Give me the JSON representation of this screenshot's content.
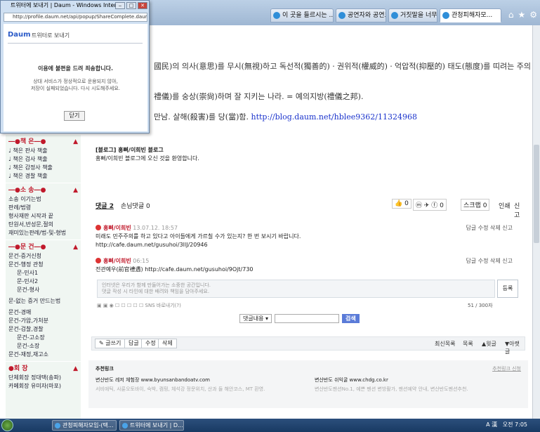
{
  "browser": {
    "tabs": [
      {
        "label": "이 곳을 들르시는 ..."
      },
      {
        "label": "공연자와 공연도..."
      },
      {
        "label": "거짓말을 너무하..."
      },
      {
        "label": "관청피해자모..."
      }
    ],
    "controls": [
      "⌂",
      "★",
      "⚙"
    ]
  },
  "popup": {
    "window_title": "트위터에 보내기 | Daum - Windows Inter...",
    "url": "http://profile.daum.net/api/popup/ShareComplete.daum",
    "logo": "Daum",
    "header": "트위터로 보내기",
    "message": "이용에 불편을 드려 죄송합니다.",
    "detail_line1": "상대 서비스가 정상적으로 운용되지 않아,",
    "detail_line2": "저장이 실패되었습니다. 다시 시도해주세요.",
    "close_button": "닫기"
  },
  "article": {
    "line1": "國民)의 의사(意思)를 무시(無視)하고 독선적(獨善的)ㆍ권위적(權威的)ㆍ억압적(抑壓的) 태도(態度)를 띠려는 주의",
    "line2": "禮儀)를 숭상(崇尙)하며 잘 지키는 나라. = 예의지방(禮儀之邦).",
    "line3_text": "만남. 살해(殺害)를 당(當)함.",
    "line3_link": "http://blog.daum.net/hblee9362/11324968"
  },
  "sidebar": {
    "sections": [
      {
        "title": "책 은",
        "items": [
          {
            "t": "♩ 책은 판사 책출"
          },
          {
            "t": "♩ 책은 검사 책출"
          },
          {
            "t": "♩ 책은 감정사 책출"
          },
          {
            "t": "♩ 책은 경찰 책출"
          }
        ]
      },
      {
        "title": "소 송",
        "items": [
          {
            "t": "소송 이기는법"
          },
          {
            "t": "판례/법령"
          },
          {
            "t": "형사재판 시작과 끝"
          },
          {
            "t": "탄원서,반성문,절의"
          },
          {
            "t": "재미있는판례/법-및-형법"
          }
        ]
      },
      {
        "title": "문 건",
        "items": [
          {
            "t": "문건-증거신청"
          },
          {
            "t": "문건-행정 관청"
          },
          {
            "t": "문-민사1",
            "ind": true
          },
          {
            "t": "문-민사2",
            "ind": true
          },
          {
            "t": "문건-형사",
            "ind": true
          },
          {
            "t": "문-없는 증거 만드는법"
          },
          {
            "t": "문건-경매"
          },
          {
            "t": "문건-가압,가처분"
          },
          {
            "t": "문건-검찰,경찰"
          },
          {
            "t": "문건-고소장",
            "ind": true
          },
          {
            "t": "문건-소장",
            "ind": true
          },
          {
            "t": "문건-재정,재고소"
          }
        ]
      },
      {
        "title": "회 장",
        "items": [
          {
            "t": "단체회장 정대택(송파)"
          },
          {
            "t": "카페회장 유미자(마포)"
          }
        ]
      }
    ]
  },
  "profile": {
    "title": "[블로그] 홍뻐/이희빈 블로그",
    "desc": "홍뻐/이희빈 블로그에 오신 것을 환영합니다."
  },
  "comment_bar": {
    "count_label": "댓글 2",
    "guest_label": "손님댓글 0",
    "like_count": "0",
    "share_count": "0",
    "scrap_label": "스크랩",
    "scrap_count": "0",
    "print_label": "인쇄",
    "report_label": "신고"
  },
  "comments": [
    {
      "author": "홍뻐/이희빈",
      "time": "13.07.12. 18:57",
      "text": "미래도 민주주의를 하고 있다고 아이들에게 가르칠 수가 있는지? 한 번 보시기 바랍니다.",
      "url": "http://cafe.daum.net/gusuhoi/3llJ/20946",
      "actions": "답글 수정 삭제 신고"
    },
    {
      "author": "홍뻐/이희빈",
      "time": "06:15",
      "text": "전관예우(前官禮遇) http://cafe.daum.net/gusuhoi/9Ojt/730",
      "url": "",
      "actions": "답글 수정 삭제 신고"
    }
  ],
  "editor": {
    "placeholder_line1": "인터넷은 우리가 함께 만들어가는 소중한 공간입니다.",
    "placeholder_line2": "댓글 작성 시 타인에 대한 배려와 책임을 담아주세요.",
    "register": "등록",
    "sns_label": "SNS 바로내기(?)",
    "counter": "51 / 300자"
  },
  "selector": {
    "option": "댓글내용",
    "search": "검색"
  },
  "actions": {
    "write": "글쓰기",
    "reply": "답글",
    "edit": "수정",
    "delete": "삭제",
    "recent": "최신목록",
    "list": "목록",
    "prev": "▲윗글",
    "next": "▼아랫글"
  },
  "footer": {
    "heading": "추천링크",
    "apply": "추천링크 신청",
    "link1_title": "변산반도 레저 체험장",
    "link1_url": "www.byunsanbandoatv.com",
    "link1_desc": "서비애틱, 사륜오토바이, 숙박, 캠핑, 체석강 정문위치, 산과 들 해안코스, MT 환영.",
    "link2_title": "변산반도 쉬익굴",
    "link2_url": "www.chdg.co.kr",
    "link2_desc": "변산반도팬션No.1, 예쁜 펜션 변방촬가, 팬션예약 안내, 변산반도펜션추천."
  },
  "taskbar": {
    "items": [
      "관청피해자모임-(택...",
      "트위터에 보내기 | D..."
    ],
    "time": "오전 7:05",
    "lang": "A 漢"
  }
}
